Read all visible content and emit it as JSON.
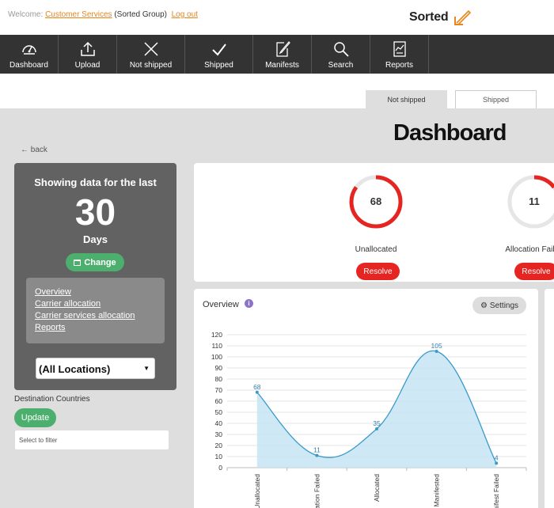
{
  "header": {
    "welcome_prefix": "Welcome:",
    "user_link": "Customer Services",
    "group": "(Sorted Group)",
    "logout": "Log out",
    "logo": "Sorted"
  },
  "nav": [
    {
      "label": "Dashboard",
      "icon": "speedometer-icon"
    },
    {
      "label": "Upload",
      "icon": "upload-icon"
    },
    {
      "label": "Not shipped",
      "icon": "close-icon"
    },
    {
      "label": "Shipped",
      "icon": "checkmark-icon"
    },
    {
      "label": "Manifests",
      "icon": "document-edit-icon"
    },
    {
      "label": "Search",
      "icon": "search-icon"
    },
    {
      "label": "Reports",
      "icon": "report-icon"
    }
  ],
  "tabs": {
    "active": "Not shipped",
    "inactive": "Shipped"
  },
  "page_title": "Dashboard",
  "back": "back",
  "filter_panel": {
    "showing": "Showing data for the last",
    "count": "30",
    "unit": "Days",
    "change": "Change",
    "links": [
      "Overview",
      "Carrier allocation",
      "Carrier services allocation",
      "Reports"
    ],
    "location": "(All Locations)"
  },
  "destination": {
    "label": "Destination Countries",
    "update": "Update",
    "placeholder": "Select to filter"
  },
  "stats": [
    {
      "value": "68",
      "label": "Unallocated",
      "action": "Resolve",
      "ring_fraction": 0.85,
      "color": "#e52521"
    },
    {
      "value": "11",
      "label": "Allocation Failed",
      "action": "Resolve",
      "ring_fraction": 0.15,
      "color": "#e52521"
    }
  ],
  "overview": {
    "title": "Overview",
    "settings": "Settings"
  },
  "chart_data": {
    "type": "area",
    "categories": [
      "Unallocated",
      "Allocation Failed",
      "Allocated",
      "Manifested",
      "Manifest Failed"
    ],
    "values": [
      68,
      11,
      35,
      105,
      4
    ],
    "ylim": [
      0,
      120
    ],
    "yticks": [
      0,
      10,
      20,
      30,
      40,
      50,
      60,
      70,
      80,
      90,
      100,
      110,
      120
    ],
    "grid": true,
    "color": "#3a9bc8",
    "fill": "#c7e4f3"
  }
}
